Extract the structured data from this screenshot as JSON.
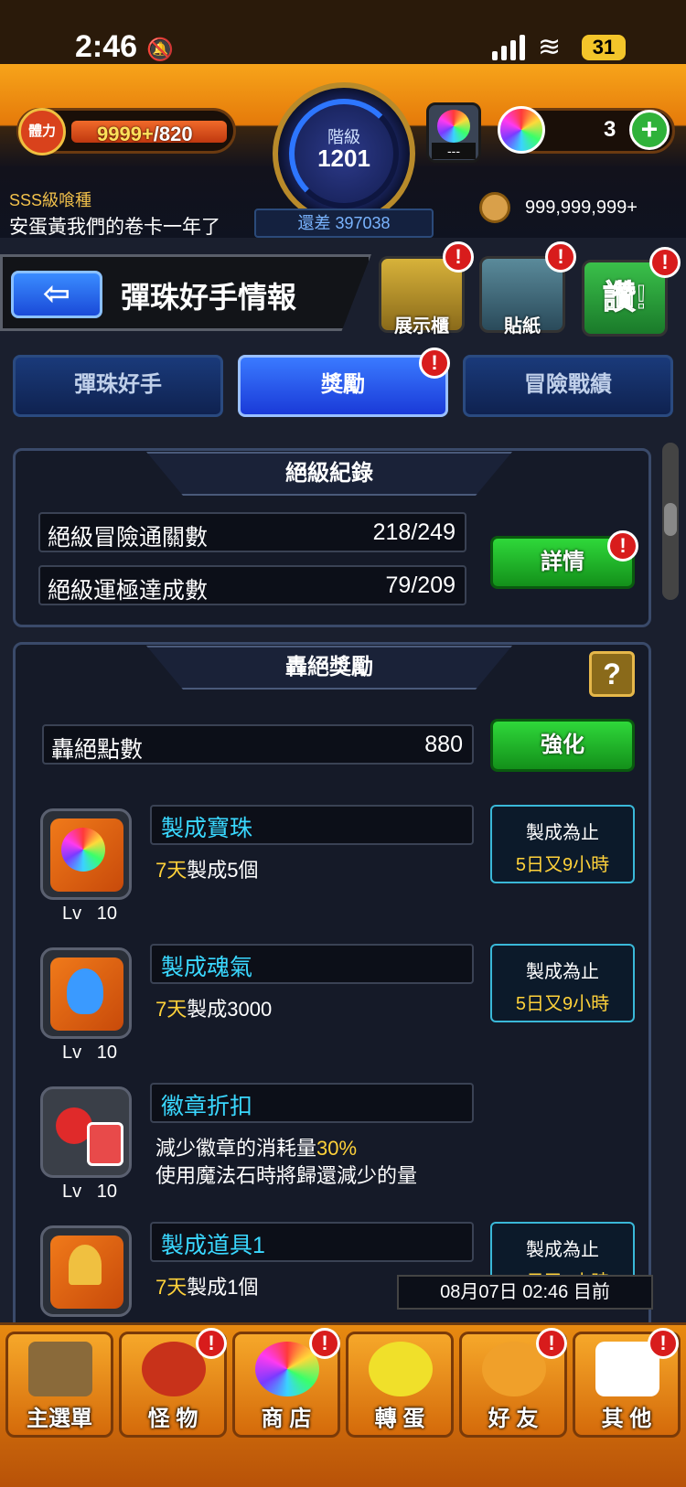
{
  "status_bar": {
    "time": "2:46",
    "battery": "31"
  },
  "header": {
    "stamina_label": "體力",
    "stamina_current": "9999+",
    "stamina_max": "/820",
    "rank_label": "階級",
    "rank_value": "1201",
    "rank_diff": "還差 397038",
    "gacha_placeholder": "---",
    "orb_count": "3",
    "user_title": "SSS級喰種",
    "user_name": "安蛋黃我們的卷卡一年了",
    "coins": "999,999,999+"
  },
  "titlebar": {
    "title": "彈珠好手情報",
    "buttons": [
      "展示櫃",
      "貼紙",
      "讚!"
    ]
  },
  "tabs": [
    "彈珠好手",
    "獎勵",
    "冒險戰績"
  ],
  "record_panel": {
    "heading": "絕級紀錄",
    "rows": [
      {
        "label": "絕級冒險通關數",
        "value": "218/249"
      },
      {
        "label": "絕級運極達成數",
        "value": "79/209"
      }
    ],
    "details_button": "詳情"
  },
  "reward_panel": {
    "heading": "轟絕獎勵",
    "help": "?",
    "points_label": "轟絕點數",
    "points_value": "880",
    "enhance_button": "強化",
    "items": [
      {
        "name": "製成寶珠",
        "desc_hl": "7天",
        "desc": "製成5個",
        "lv": "Lv",
        "lv_num": "10",
        "timer_l1": "製成為止",
        "timer_l2": "5日又9小時"
      },
      {
        "name": "製成魂氣",
        "desc_hl": "7天",
        "desc": "製成3000",
        "lv": "Lv",
        "lv_num": "10",
        "timer_l1": "製成為止",
        "timer_l2": "5日又9小時"
      },
      {
        "name": "徽章折扣",
        "desc_pre": "減少徽章的消耗量",
        "desc_hl": "30%",
        "desc2": "使用魔法石時將歸還減少的量",
        "lv": "Lv",
        "lv_num": "10"
      },
      {
        "name": "製成道具1",
        "desc_hl": "7天",
        "desc": "製成1個",
        "timer_l1": "製成為止",
        "timer_l2": "5日又9小時"
      }
    ]
  },
  "date_stamp": "08月07日 02:46 目前",
  "bottom_nav": [
    "主選單",
    "怪 物",
    "商 店",
    "轉 蛋",
    "好 友",
    "其 他"
  ],
  "colors": {
    "accent_orange": "#e88a10",
    "accent_blue": "#1a3ad8",
    "green": "#2fd83a",
    "alert_red": "#d81c1c",
    "highlight_yellow": "#ffd23a",
    "cyan": "#3ad8ff"
  }
}
